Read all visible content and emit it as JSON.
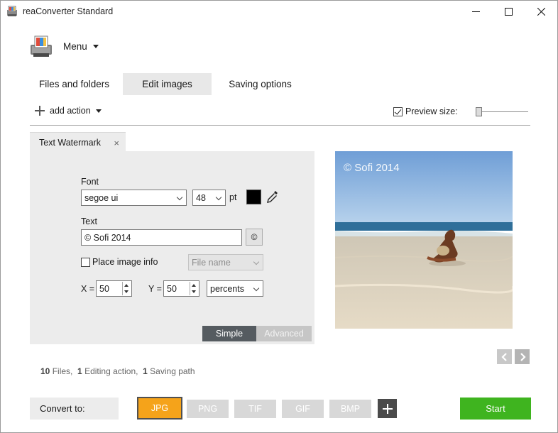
{
  "window": {
    "title": "reaConverter Standard",
    "controls": [
      "minimize",
      "maximize",
      "close"
    ]
  },
  "menu": {
    "label": "Menu"
  },
  "tabs": [
    {
      "label": "Files and folders",
      "active": false
    },
    {
      "label": "Edit images",
      "active": true
    },
    {
      "label": "Saving options",
      "active": false
    }
  ],
  "toolbar": {
    "add_action_label": "add action",
    "preview_size_label": "Preview size:",
    "preview_size_checked": true,
    "preview_size_level": 0.0
  },
  "action_tab": {
    "label": "Text Watermark",
    "close_glyph": "×"
  },
  "watermark": {
    "font_label": "Font",
    "font_value": "segoe ui",
    "size_value": "48",
    "size_unit": "pt",
    "color": "#000000",
    "text_label": "Text",
    "text_value": "© Sofi 2014",
    "copyright_button": "©",
    "place_info_label": "Place image info",
    "place_info_checked": false,
    "info_select_value": "File name",
    "x_label": "X =",
    "x_value": "50",
    "y_label": "Y =",
    "y_value": "50",
    "units_value": "percents",
    "mode_simple": "Simple",
    "mode_advanced": "Advanced",
    "active_mode": "Simple"
  },
  "preview": {
    "watermark_text": "© Sofi 2014"
  },
  "status": {
    "files_count": "10",
    "files_label": "Files,",
    "actions_count": "1",
    "actions_label": "Editing action,",
    "paths_count": "1",
    "paths_label": "Saving path"
  },
  "convert": {
    "label": "Convert to:",
    "formats": [
      "JPG",
      "PNG",
      "TIF",
      "GIF",
      "BMP"
    ],
    "selected": "JPG",
    "start_label": "Start"
  },
  "colors": {
    "accent_orange": "#f5a31a",
    "start_green": "#3fb41f",
    "simple_active": "#555b60"
  }
}
